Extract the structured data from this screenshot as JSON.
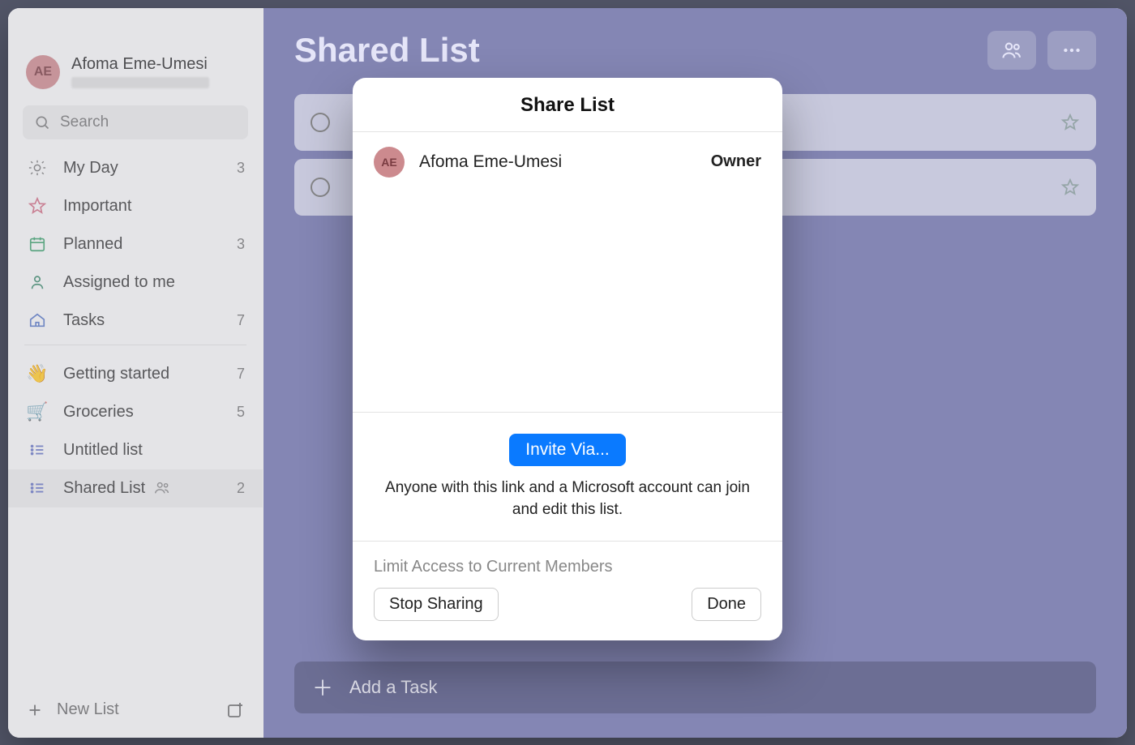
{
  "user": {
    "name": "Afoma Eme-Umesi",
    "initials": "AE"
  },
  "search": {
    "placeholder": "Search"
  },
  "sidebar": {
    "items": [
      {
        "iconKind": "sun",
        "label": "My Day",
        "count": "3"
      },
      {
        "iconKind": "star",
        "label": "Important",
        "count": ""
      },
      {
        "iconKind": "calendar",
        "label": "Planned",
        "count": "3"
      },
      {
        "iconKind": "person",
        "label": "Assigned to me",
        "count": ""
      },
      {
        "iconKind": "home",
        "label": "Tasks",
        "count": "7"
      }
    ],
    "userLists": [
      {
        "emoji": "👋",
        "label": "Getting started",
        "count": "7",
        "shared": false,
        "active": false
      },
      {
        "emoji": "🛒",
        "label": "Groceries",
        "count": "5",
        "shared": false,
        "active": false
      },
      {
        "iconKind": "list",
        "label": "Untitled list",
        "count": "",
        "shared": false,
        "active": false
      },
      {
        "iconKind": "list",
        "label": "Shared List",
        "count": "2",
        "shared": true,
        "active": true
      }
    ],
    "newList": "New List"
  },
  "main": {
    "title": "Shared List",
    "addTask": "Add a Task",
    "taskCount": 2
  },
  "modal": {
    "title": "Share List",
    "member": {
      "name": "Afoma Eme-Umesi",
      "initials": "AE",
      "role": "Owner"
    },
    "inviteButton": "Invite Via...",
    "inviteDescription": "Anyone with this link and a Microsoft account can join and edit this list.",
    "limitLabel": "Limit Access to Current Members",
    "stopSharing": "Stop Sharing",
    "done": "Done"
  },
  "colors": {
    "accent": "#0a7aff",
    "mainBg": "#8789b8",
    "avatarBg": "#cc8a8e"
  }
}
